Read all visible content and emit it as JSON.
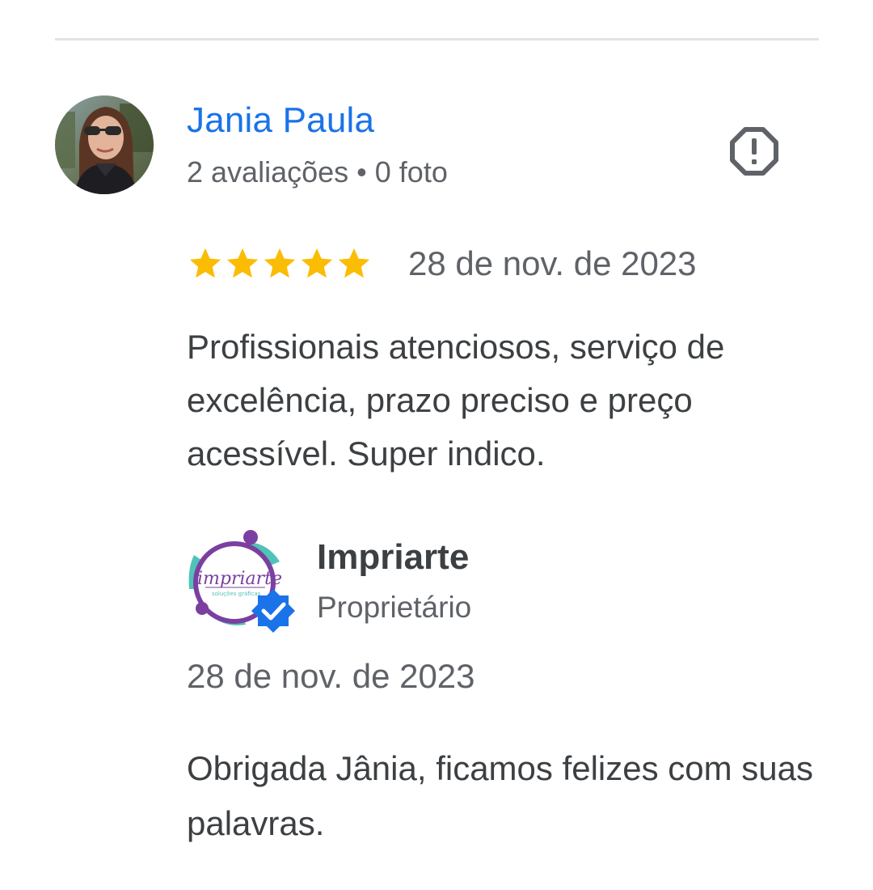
{
  "review": {
    "reviewer": {
      "name": "Jania Paula",
      "reviews_count": "2 avaliações",
      "separator": "•",
      "photos_count": "0 foto"
    },
    "rating": 5,
    "max_rating": 5,
    "date": "28 de nov. de 2023",
    "text": "Profissionais atenciosos, serviço de excelência, prazo preciso e preço acessível. Super indico."
  },
  "owner_reply": {
    "name": "Impriarte",
    "role": "Proprietário",
    "logo_text": "impriarte",
    "logo_tagline": "soluções gráficas",
    "date": "28 de nov. de 2023",
    "text": "Obrigada Jânia, ficamos felizes com suas palavras."
  },
  "icons": {
    "report": "report-octagon-icon",
    "verified": "verified-badge-icon",
    "star": "star-icon"
  },
  "colors": {
    "name_link": "#1a73e8",
    "star": "#fbbc04",
    "text_primary": "#3c4043",
    "text_secondary": "#5f6368",
    "divider": "#e3e3e3",
    "verified_badge": "#1a73e8",
    "logo_purple": "#7b3fa0",
    "logo_teal": "#4fc3b7"
  }
}
